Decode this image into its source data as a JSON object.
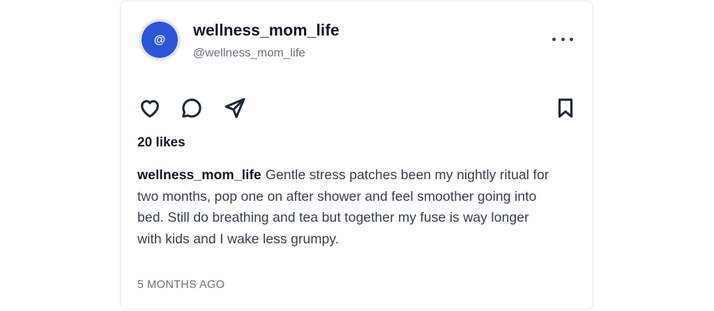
{
  "post": {
    "avatar": {
      "glyph": "@",
      "color": "#2d55d9"
    },
    "display_name": "wellness_mom_life",
    "handle": "@wellness_mom_life",
    "actions": {
      "like_icon": "heart-icon",
      "comment_icon": "comment-icon",
      "share_icon": "send-icon",
      "save_icon": "bookmark-icon",
      "more_icon": "more-horizontal-icon"
    },
    "likes_text": "20 likes",
    "caption": {
      "username": "wellness_mom_life",
      "text": "Gentle stress patches been my nightly ritual for two months, pop one on after shower and feel smoother going into bed. Still do breathing and tea but together my fuse is way longer with kids and I wake less grumpy."
    },
    "timestamp": "5 MONTHS AGO"
  }
}
